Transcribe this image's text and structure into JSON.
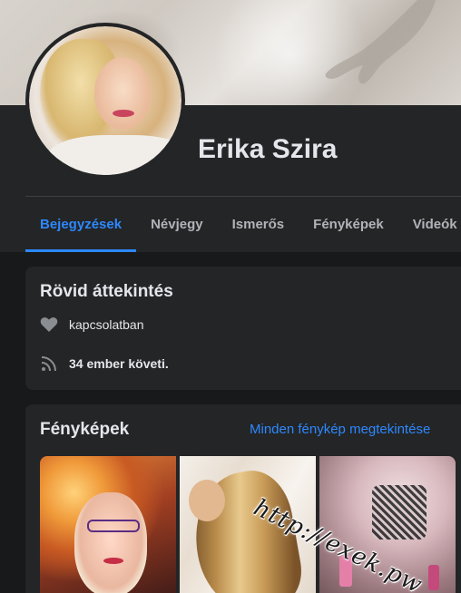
{
  "profile": {
    "name": "Erika Szira"
  },
  "tabs": [
    {
      "label": "Bejegyzések",
      "active": true
    },
    {
      "label": "Névjegy"
    },
    {
      "label": "Ismerős"
    },
    {
      "label": "Fényképek"
    },
    {
      "label": "Videók"
    }
  ],
  "overview": {
    "title": "Rövid áttekintés",
    "relationship": "kapcsolatban",
    "followers": "34 ember követi."
  },
  "photos": {
    "title": "Fényképek",
    "see_all": "Minden fénykép megtekintése",
    "watermark": "http://exek.pw"
  },
  "icons": {
    "relationship": "heart-icon",
    "followers": "rss-feed-icon"
  },
  "colors": {
    "accent": "#2d88ff",
    "background": "#18191a",
    "card": "#242526",
    "text": "#e4e6eb",
    "secondary_text": "#b0b3b8"
  }
}
